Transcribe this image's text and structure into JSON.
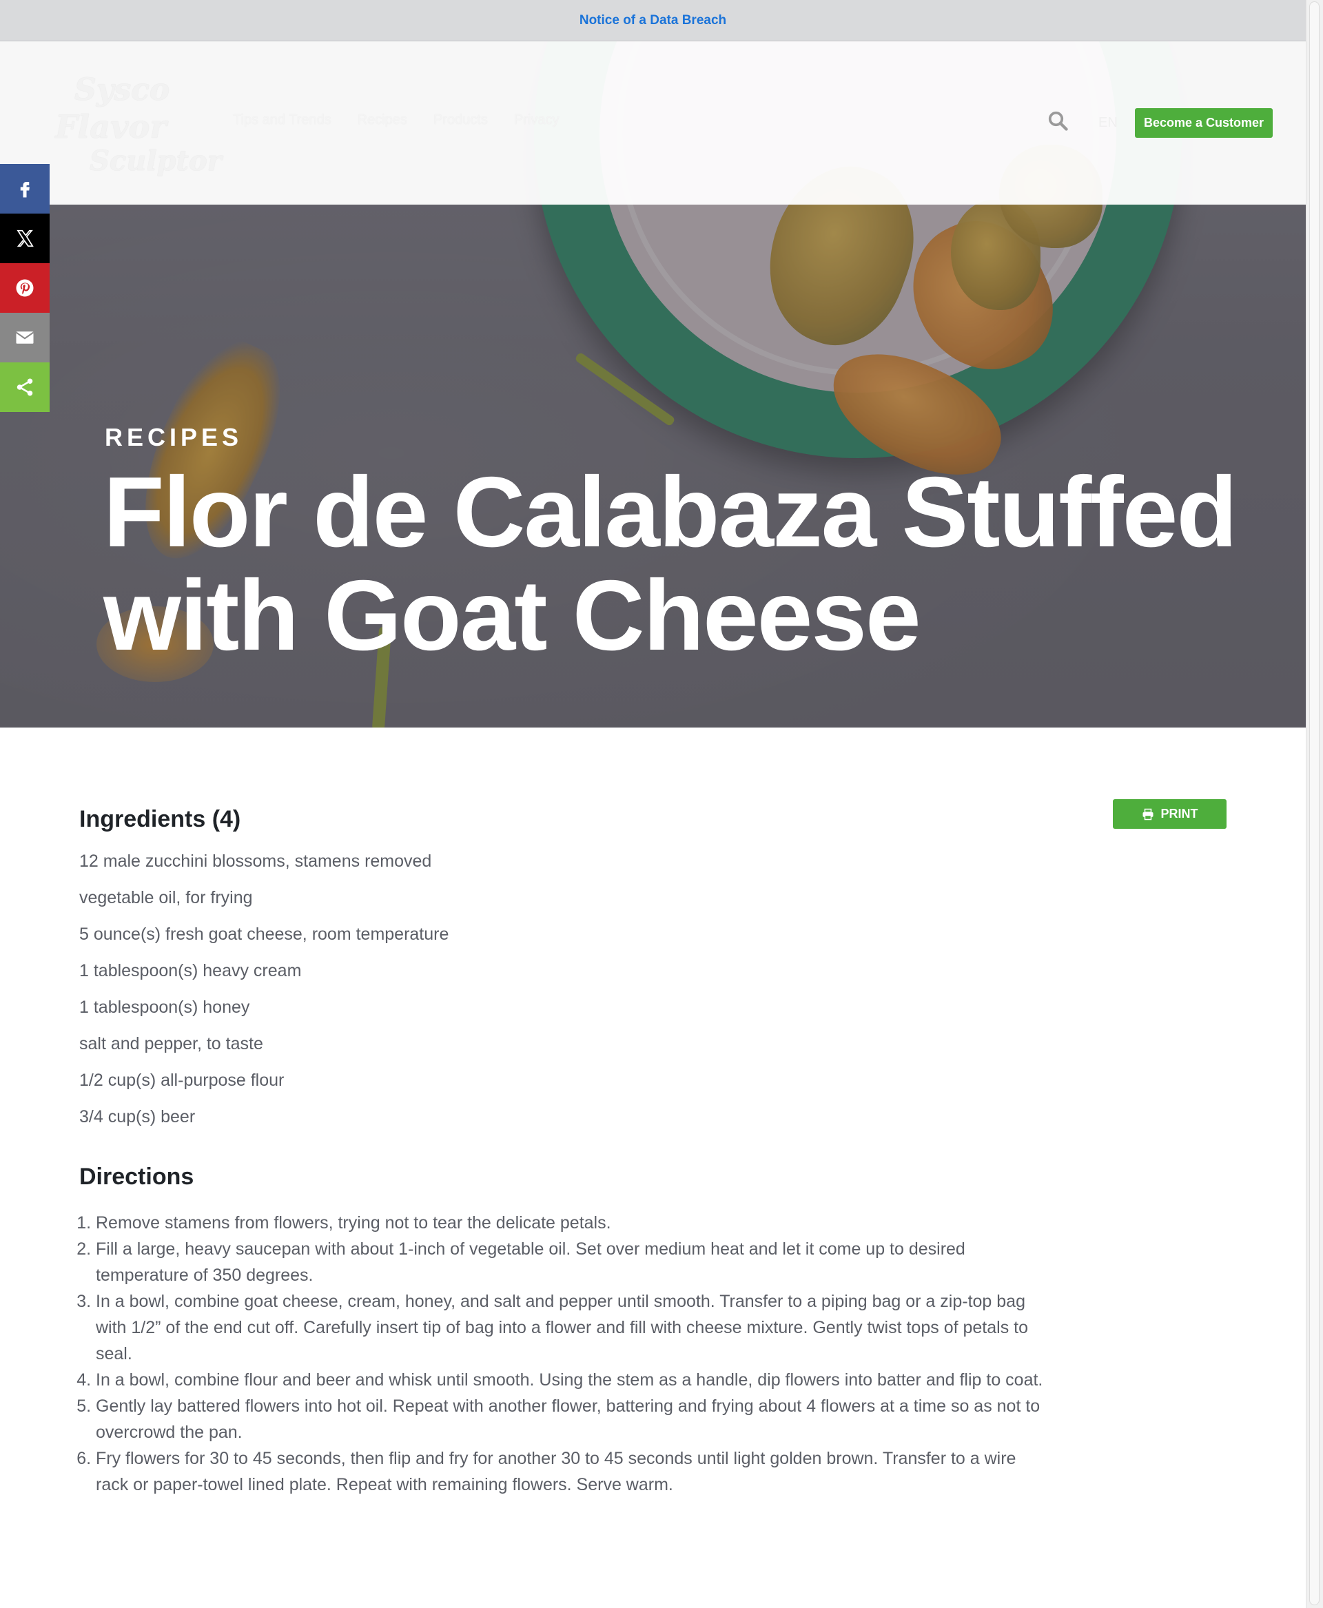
{
  "notice": {
    "text": "Notice of a Data Breach"
  },
  "header": {
    "logo_lines": [
      "Sysco",
      "Flavor",
      "Sculptor"
    ],
    "nav": [
      "Tips and Trends",
      "Recipes",
      "Products",
      "Privacy"
    ],
    "lang": "EN",
    "cta": "Become a Customer",
    "search_icon": "search-icon"
  },
  "share": {
    "buttons": [
      "facebook-icon",
      "x-icon",
      "pinterest-icon",
      "email-icon",
      "share-icon"
    ],
    "colors": {
      "facebook": "#3b5998",
      "x": "#000000",
      "pinterest": "#cb2027",
      "email": "#888888",
      "share": "#7cc142"
    }
  },
  "hero": {
    "kicker": "RECIPES",
    "title": "Flor de Calabaza Stuffed with Goat Cheese"
  },
  "recipe": {
    "print_label": "PRINT",
    "ingredients_heading": "Ingredients (4)",
    "ingredients": [
      "12 male zucchini blossoms, stamens removed",
      "vegetable oil, for frying",
      "5 ounce(s) fresh goat cheese, room temperature",
      "1 tablespoon(s) heavy cream",
      "1 tablespoon(s) honey",
      "salt and pepper, to taste",
      "1/2 cup(s) all-purpose flour",
      "3/4 cup(s) beer"
    ],
    "directions_heading": "Directions",
    "directions": [
      "Remove stamens from flowers, trying not to tear the delicate petals.",
      "Fill a large, heavy saucepan with about 1-inch of vegetable oil. Set over medium heat and let it come up to desired temperature of 350 degrees.",
      "In a bowl, combine goat cheese, cream, honey, and salt and pepper until smooth. Transfer to a piping bag or a zip-top bag with 1/2” of the end cut off. Carefully insert tip of bag into a flower and fill with cheese mixture. Gently twist tops of petals to seal.",
      "In a bowl, combine flour and beer and whisk until smooth. Using the stem as a handle, dip flowers into batter and flip to coat.",
      "Gently lay battered flowers into hot oil. Repeat with another flower, battering and frying about 4 flowers at a time so as not to overcrowd the pan.",
      "Fry flowers for 30 to 45 seconds, then flip and fry for another 30 to 45 seconds until light golden brown. Transfer to a wire rack or paper-towel lined plate. Repeat with remaining flowers. Serve warm."
    ]
  },
  "colors": {
    "accent_green": "#4eae3c",
    "notice_link": "#1a73d9"
  }
}
